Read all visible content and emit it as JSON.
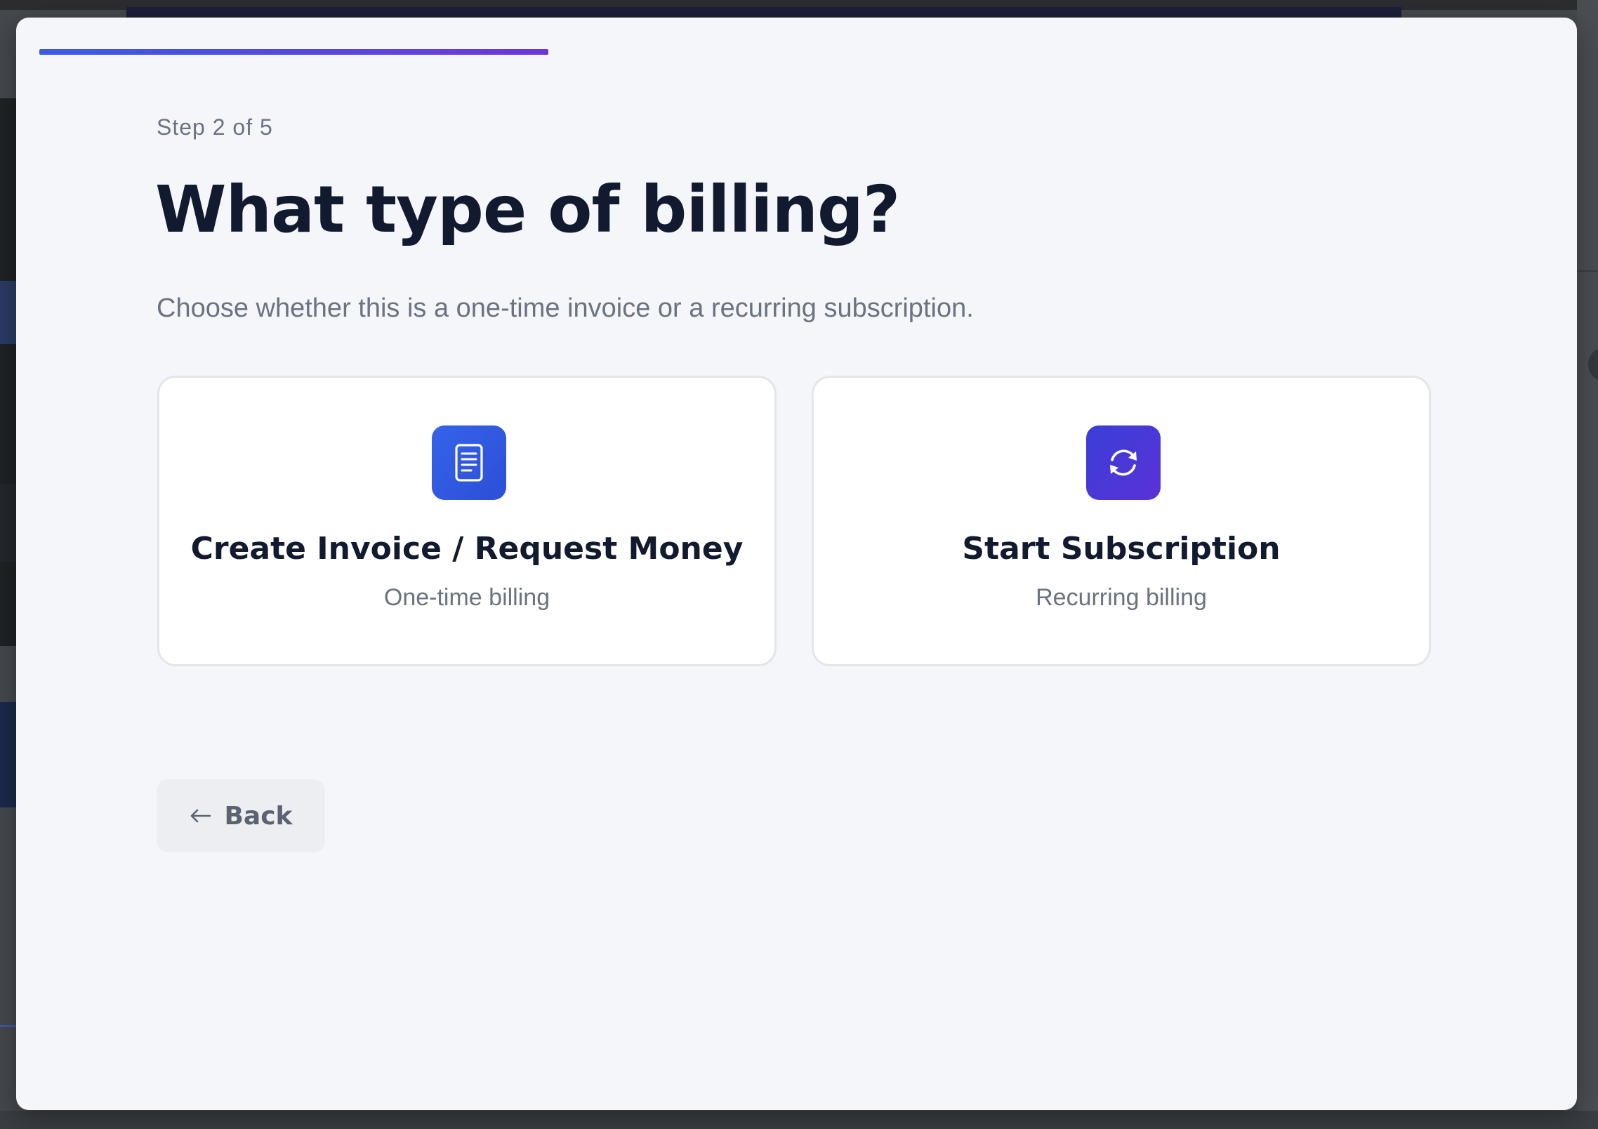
{
  "wizard": {
    "progress": 0.4,
    "step_label": "Step 2 of 5",
    "title": "What type of billing?",
    "subtitle": "Choose whether this is a one-time invoice or a recurring subscription."
  },
  "options": [
    {
      "title": "Create Invoice / Request Money",
      "subtitle": "One-time billing",
      "icon": "document-icon",
      "color": "#2f5ae0"
    },
    {
      "title": "Start Subscription",
      "subtitle": "Recurring billing",
      "icon": "refresh-icon",
      "color": "#4a36d8"
    }
  ],
  "actions": {
    "back_label": "Back"
  },
  "colors": {
    "accent_start": "#3b5be0",
    "accent_end": "#6f35d9",
    "heading": "#111a2e",
    "muted": "#6b7280"
  }
}
